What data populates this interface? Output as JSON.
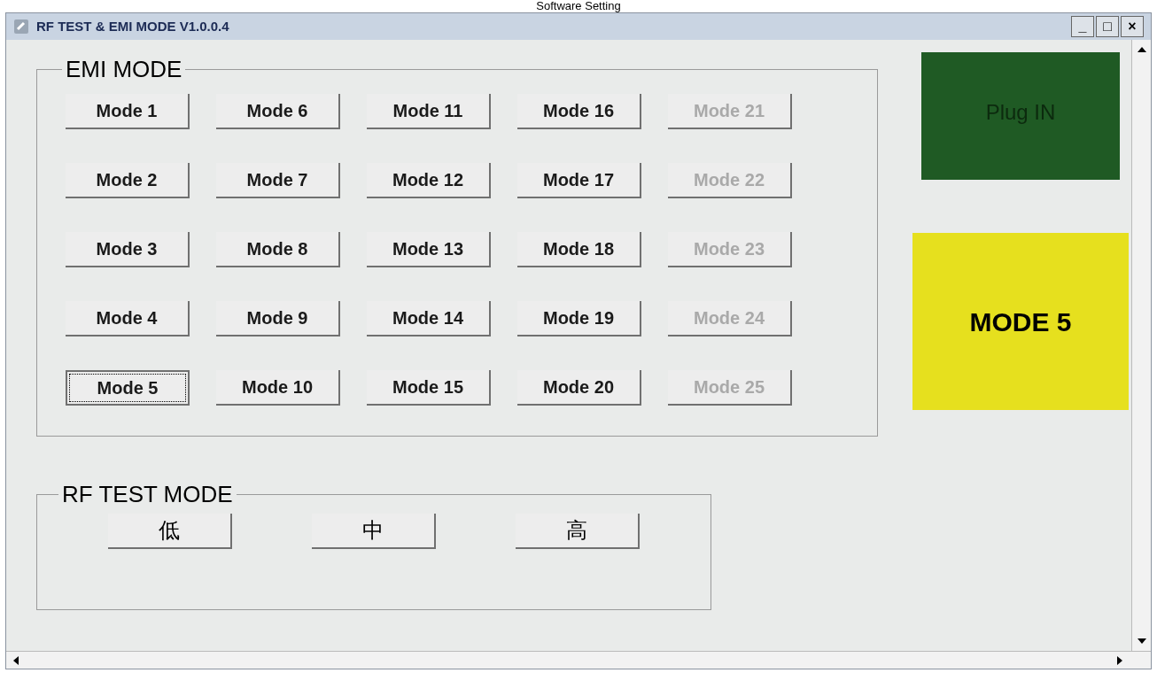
{
  "caption": "Software Setting",
  "window": {
    "title": "RF TEST & EMI MODE V1.0.0.4",
    "controls": [
      "_",
      "□",
      "×"
    ]
  },
  "emi_group": {
    "title": "EMI MODE",
    "columns": [
      [
        {
          "label": "Mode 1",
          "disabled": false,
          "selected": false
        },
        {
          "label": "Mode 2",
          "disabled": false,
          "selected": false
        },
        {
          "label": "Mode 3",
          "disabled": false,
          "selected": false
        },
        {
          "label": "Mode 4",
          "disabled": false,
          "selected": false
        },
        {
          "label": "Mode 5",
          "disabled": false,
          "selected": true
        }
      ],
      [
        {
          "label": "Mode 6",
          "disabled": false,
          "selected": false
        },
        {
          "label": "Mode 7",
          "disabled": false,
          "selected": false
        },
        {
          "label": "Mode 8",
          "disabled": false,
          "selected": false
        },
        {
          "label": "Mode 9",
          "disabled": false,
          "selected": false
        },
        {
          "label": "Mode 10",
          "disabled": false,
          "selected": false
        }
      ],
      [
        {
          "label": "Mode 11",
          "disabled": false,
          "selected": false
        },
        {
          "label": "Mode 12",
          "disabled": false,
          "selected": false
        },
        {
          "label": "Mode 13",
          "disabled": false,
          "selected": false
        },
        {
          "label": "Mode 14",
          "disabled": false,
          "selected": false
        },
        {
          "label": "Mode 15",
          "disabled": false,
          "selected": false
        }
      ],
      [
        {
          "label": "Mode 16",
          "disabled": false,
          "selected": false
        },
        {
          "label": "Mode 17",
          "disabled": false,
          "selected": false
        },
        {
          "label": "Mode 18",
          "disabled": false,
          "selected": false
        },
        {
          "label": "Mode 19",
          "disabled": false,
          "selected": false
        },
        {
          "label": "Mode 20",
          "disabled": false,
          "selected": false
        }
      ],
      [
        {
          "label": "Mode 21",
          "disabled": true,
          "selected": false
        },
        {
          "label": "Mode 22",
          "disabled": true,
          "selected": false
        },
        {
          "label": "Mode 23",
          "disabled": true,
          "selected": false
        },
        {
          "label": "Mode 24",
          "disabled": true,
          "selected": false
        },
        {
          "label": "Mode 25",
          "disabled": true,
          "selected": false
        }
      ]
    ]
  },
  "status_panels": [
    {
      "text": "Plug IN",
      "color": "#1f5a24"
    },
    {
      "text": "MODE 5",
      "color": "#e6e01e"
    }
  ],
  "rf_group": {
    "title": "RF TEST MODE",
    "buttons": [
      "低",
      "中",
      "高"
    ]
  }
}
